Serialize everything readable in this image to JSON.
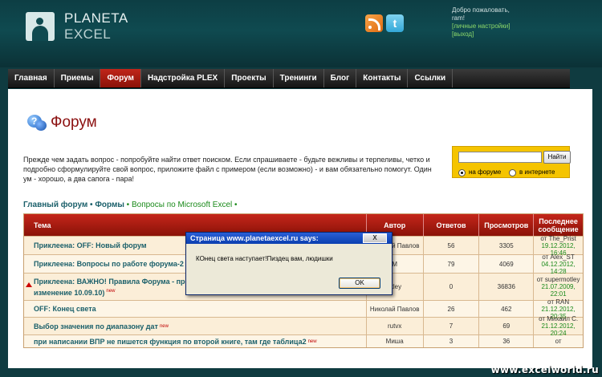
{
  "brand": {
    "line1": "PLANETA",
    "line2": "EXCEL"
  },
  "user": {
    "greeting": "Добро пожаловать,",
    "name": "ram!",
    "settings": "[личные настройки]",
    "logout": "[выход]"
  },
  "nav": [
    "Главная",
    "Приемы",
    "Форум",
    "Надстройка PLEX",
    "Проекты",
    "Тренинги",
    "Блог",
    "Контакты",
    "Ссылки"
  ],
  "nav_active": "Форум",
  "page_title": "Форум",
  "intro": "Прежде чем задать вопрос - попробуйте найти ответ поиском. Если спрашиваете - будьте вежливы и терпеливы, четко и подробно сформулируйте свой вопрос, приложите файл с примером (если возможно) - и вам обязательно помогут. Один ум - хорошо, а два сапога - пара!",
  "search": {
    "button": "Найти",
    "opt1": "на форуме",
    "opt2": "в интернете"
  },
  "breadcrumb": {
    "main": "Главный форум",
    "sep": " • ",
    "forums": "Формы",
    "current": "Вопросы по Microsoft Excel",
    "tail": " •"
  },
  "table": {
    "headers": {
      "topic": "Тема",
      "author": "Автор",
      "replies": "Ответов",
      "views": "Просмотров",
      "last": "Последнее сообщение"
    },
    "rows": [
      {
        "topic": "Приклеена: OFF: Новый форум",
        "new": "",
        "author": "Николай Павлов",
        "replies": "56",
        "views": "3305",
        "last_by": "от The_Prist",
        "last_date": "19.12.2012, 16:46"
      },
      {
        "topic": "Приклеена: Вопросы по работе форума-2 (п",
        "new": "",
        "author": "M",
        "replies": "79",
        "views": "4069",
        "last_by": "от Alex_ST",
        "last_date": "04.12.2012, 14:28"
      },
      {
        "topic": "Приклеена: ВАЖНО! Правила Форума - проч",
        "topic2": "изменение 10.09.10)",
        "new": "new",
        "author": "otley",
        "replies": "0",
        "views": "36836",
        "last_by": "от supermotley",
        "last_date": "21.07.2009, 22:01"
      },
      {
        "topic": "OFF: Конец света",
        "new": "",
        "author": "Николай Павлов",
        "replies": "26",
        "views": "462",
        "last_by": "от RAN",
        "last_date": "21.12.2012, 20:35"
      },
      {
        "topic": "Выбор значения по диапазону дат",
        "new": "new",
        "author": "rutvx",
        "replies": "7",
        "views": "69",
        "last_by": "от Михаил С.",
        "last_date": "21.12.2012, 20:24"
      },
      {
        "topic": "при написании ВПР не пишется функция по второй книге, там где таблица2",
        "new": "new",
        "author": "Миша",
        "replies": "3",
        "views": "36",
        "last_by": "от",
        "last_date": ""
      }
    ]
  },
  "dialog": {
    "title": "Страница www.planetaexcel.ru says:",
    "close": "X",
    "message": "КОнец света наступает!Пиздец вам, людишки",
    "ok": "OK"
  },
  "watermark": "www.excelworld.ru"
}
